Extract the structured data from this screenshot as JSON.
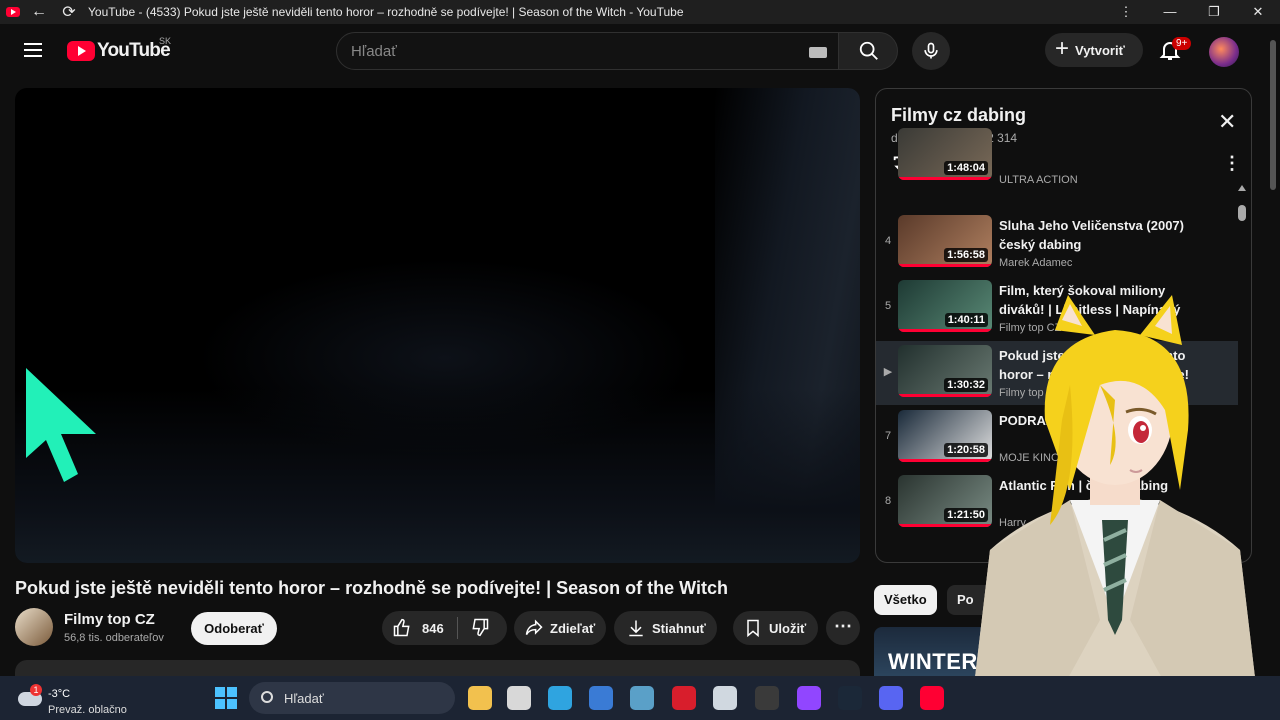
{
  "browser": {
    "tab_title": "YouTube - (4533) Pokud jste ještě neviděli tento horor – rozhodně se podívejte! | Season of the Witch - YouTube",
    "back_icon": "arrow-left-icon",
    "reload_icon": "reload-icon"
  },
  "header": {
    "logo_text": "YouTube",
    "country": "SK",
    "search_placeholder": "Hľadať",
    "create_label": "Vytvoriť",
    "notification_badge": "9+"
  },
  "video": {
    "title": "Pokud jste ještě neviděli tento horor – rozhodně se podívejte! | Season of the Witch",
    "channel_name": "Filmy top CZ",
    "subscribers": "56,8 tis. odberateľov",
    "subscribe_label": "Odoberať",
    "likes": "846",
    "share_label": "Zdieľať",
    "download_label": "Stiahnuť",
    "save_label": "Uložiť"
  },
  "playlist": {
    "title": "Filmy cz dabing",
    "meta": "dusan chupan - 6/2 314",
    "items": [
      {
        "index": "",
        "title": "",
        "channel": "ULTRA ACTION",
        "duration": "1:48:04",
        "thumb": [
          "#3a3a36",
          "#7a6a58"
        ]
      },
      {
        "index": "4",
        "title": "Sluha Jeho Veličenstva (2007) český dabing",
        "channel": "Marek Adamec",
        "duration": "1:56:58",
        "thumb": [
          "#5a3a2a",
          "#b08060"
        ]
      },
      {
        "index": "5",
        "title": "Film, který šokoval miliony diváků! | Limitless | Napínavý",
        "channel": "Filmy top CZ",
        "duration": "1:40:11",
        "thumb": [
          "#1e3a34",
          "#5a8a76"
        ]
      },
      {
        "index": "▶",
        "title": "Pokud jste ještě neviděli tento horor – rozhodně se podívejte!",
        "channel": "Filmy top CZ",
        "duration": "1:30:32",
        "thumb": [
          "#22302e",
          "#6a7a72"
        ]
      },
      {
        "index": "7",
        "title": "PODRAZ | Akční, Drama",
        "channel": "MOJE KINO",
        "duration": "1:20:58",
        "thumb": [
          "#1a2a3a",
          "#e0e0e0"
        ]
      },
      {
        "index": "8",
        "title": "Atlantic Rim | český dabing",
        "channel": "Harry",
        "duration": "1:21:50",
        "thumb": [
          "#2a3430",
          "#7a8c84"
        ]
      }
    ]
  },
  "chips": [
    "Všetko",
    "Po"
  ],
  "promo_text": "WINTER",
  "taskbar": {
    "weather_temp": "-3°C",
    "weather_cond": "Prevaž. oblačno",
    "weather_badge": "1",
    "search_placeholder": "Hľadať",
    "apps": [
      {
        "name": "file-explorer",
        "color": "#f2c14e"
      },
      {
        "name": "task-view",
        "color": "#d8d8d8"
      },
      {
        "name": "edge",
        "color": "#2fa4e0"
      },
      {
        "name": "ms-store",
        "color": "#3a7bd5"
      },
      {
        "name": "desktop-app",
        "color": "#5aa0c8"
      },
      {
        "name": "amd",
        "color": "#d81e2c"
      },
      {
        "name": "vegas",
        "color": "#d0d8e0"
      },
      {
        "name": "obs",
        "color": "#3a3a3a"
      },
      {
        "name": "twitch",
        "color": "#9146ff"
      },
      {
        "name": "steam",
        "color": "#1b2838"
      },
      {
        "name": "discord",
        "color": "#5865f2"
      },
      {
        "name": "youtube",
        "color": "#ff0033"
      }
    ]
  }
}
